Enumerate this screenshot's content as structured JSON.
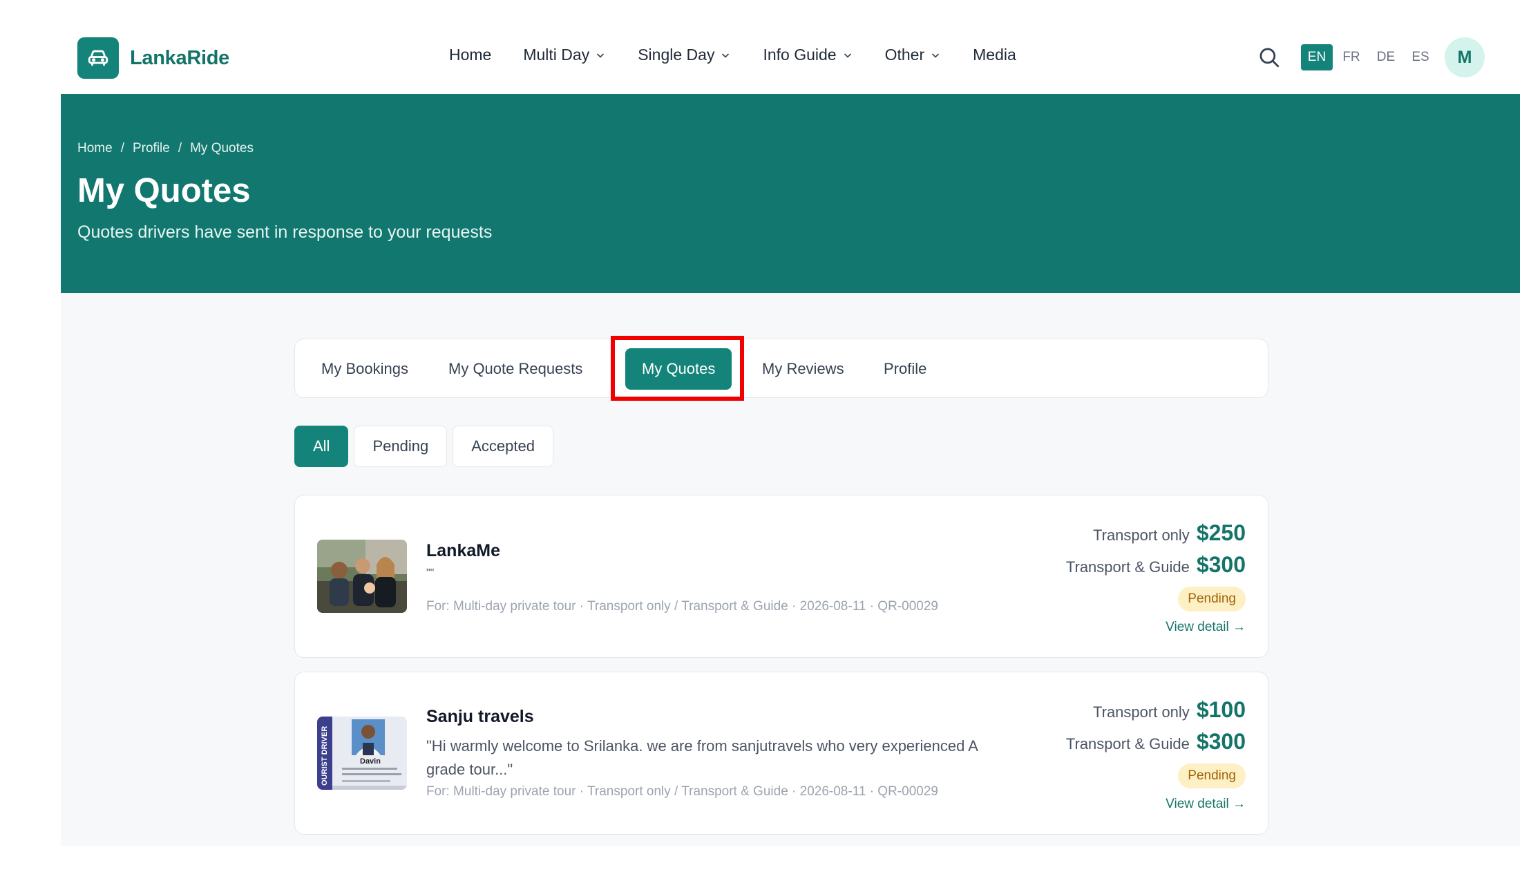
{
  "brand": {
    "name": "LankaRide",
    "icon": "car-icon"
  },
  "nav": {
    "items": [
      {
        "label": "Home",
        "dropdown": false
      },
      {
        "label": "Multi Day",
        "dropdown": true
      },
      {
        "label": "Single Day",
        "dropdown": true
      },
      {
        "label": "Info Guide",
        "dropdown": true
      },
      {
        "label": "Other",
        "dropdown": true
      },
      {
        "label": "Media",
        "dropdown": false
      }
    ]
  },
  "header": {
    "search_icon": "search-icon",
    "languages": [
      "EN",
      "FR",
      "DE",
      "ES"
    ],
    "active_language": "EN",
    "avatar_initial": "M"
  },
  "hero": {
    "breadcrumb": [
      "Home",
      "Profile",
      "My Quotes"
    ],
    "title": "My Quotes",
    "subtitle": "Quotes drivers have sent in response to your requests"
  },
  "tabs": {
    "items": [
      "My Bookings",
      "My Quote Requests",
      "My Quotes",
      "My Reviews",
      "Profile"
    ],
    "active": "My Quotes"
  },
  "filters": {
    "items": [
      "All",
      "Pending",
      "Accepted"
    ],
    "active": "All"
  },
  "quotes": [
    {
      "driver": "LankaMe",
      "message": "\"\"",
      "meta": "For: Multi-day private tour · Transport only / Transport & Guide · 2026-08-11 · QR-00029",
      "transport_label": "Transport only",
      "transport_price": "$250",
      "guide_label": "Transport & Guide",
      "guide_price": "$300",
      "status": "Pending",
      "link": "View detail →"
    },
    {
      "driver": "Sanju travels",
      "message": "\"Hi warmly welcome to Srilanka. we are from sanjutravels who very experienced A grade tour...\"",
      "meta": "For: Multi-day private tour · Transport only / Transport & Guide · 2026-08-11 · QR-00029",
      "transport_label": "Transport only",
      "transport_price": "$100",
      "guide_label": "Transport & Guide",
      "guide_price": "$300",
      "status": "Pending",
      "link": "View detail →",
      "id_card": {
        "side_text": "OURIST DRIVER",
        "name": "Davin"
      }
    }
  ],
  "colors": {
    "primary": "#14847a",
    "hero_bg": "#11776f",
    "price": "#137468",
    "pending_bg": "#fdf0c4",
    "pending_text": "#a16207",
    "highlight": "#f20000"
  }
}
